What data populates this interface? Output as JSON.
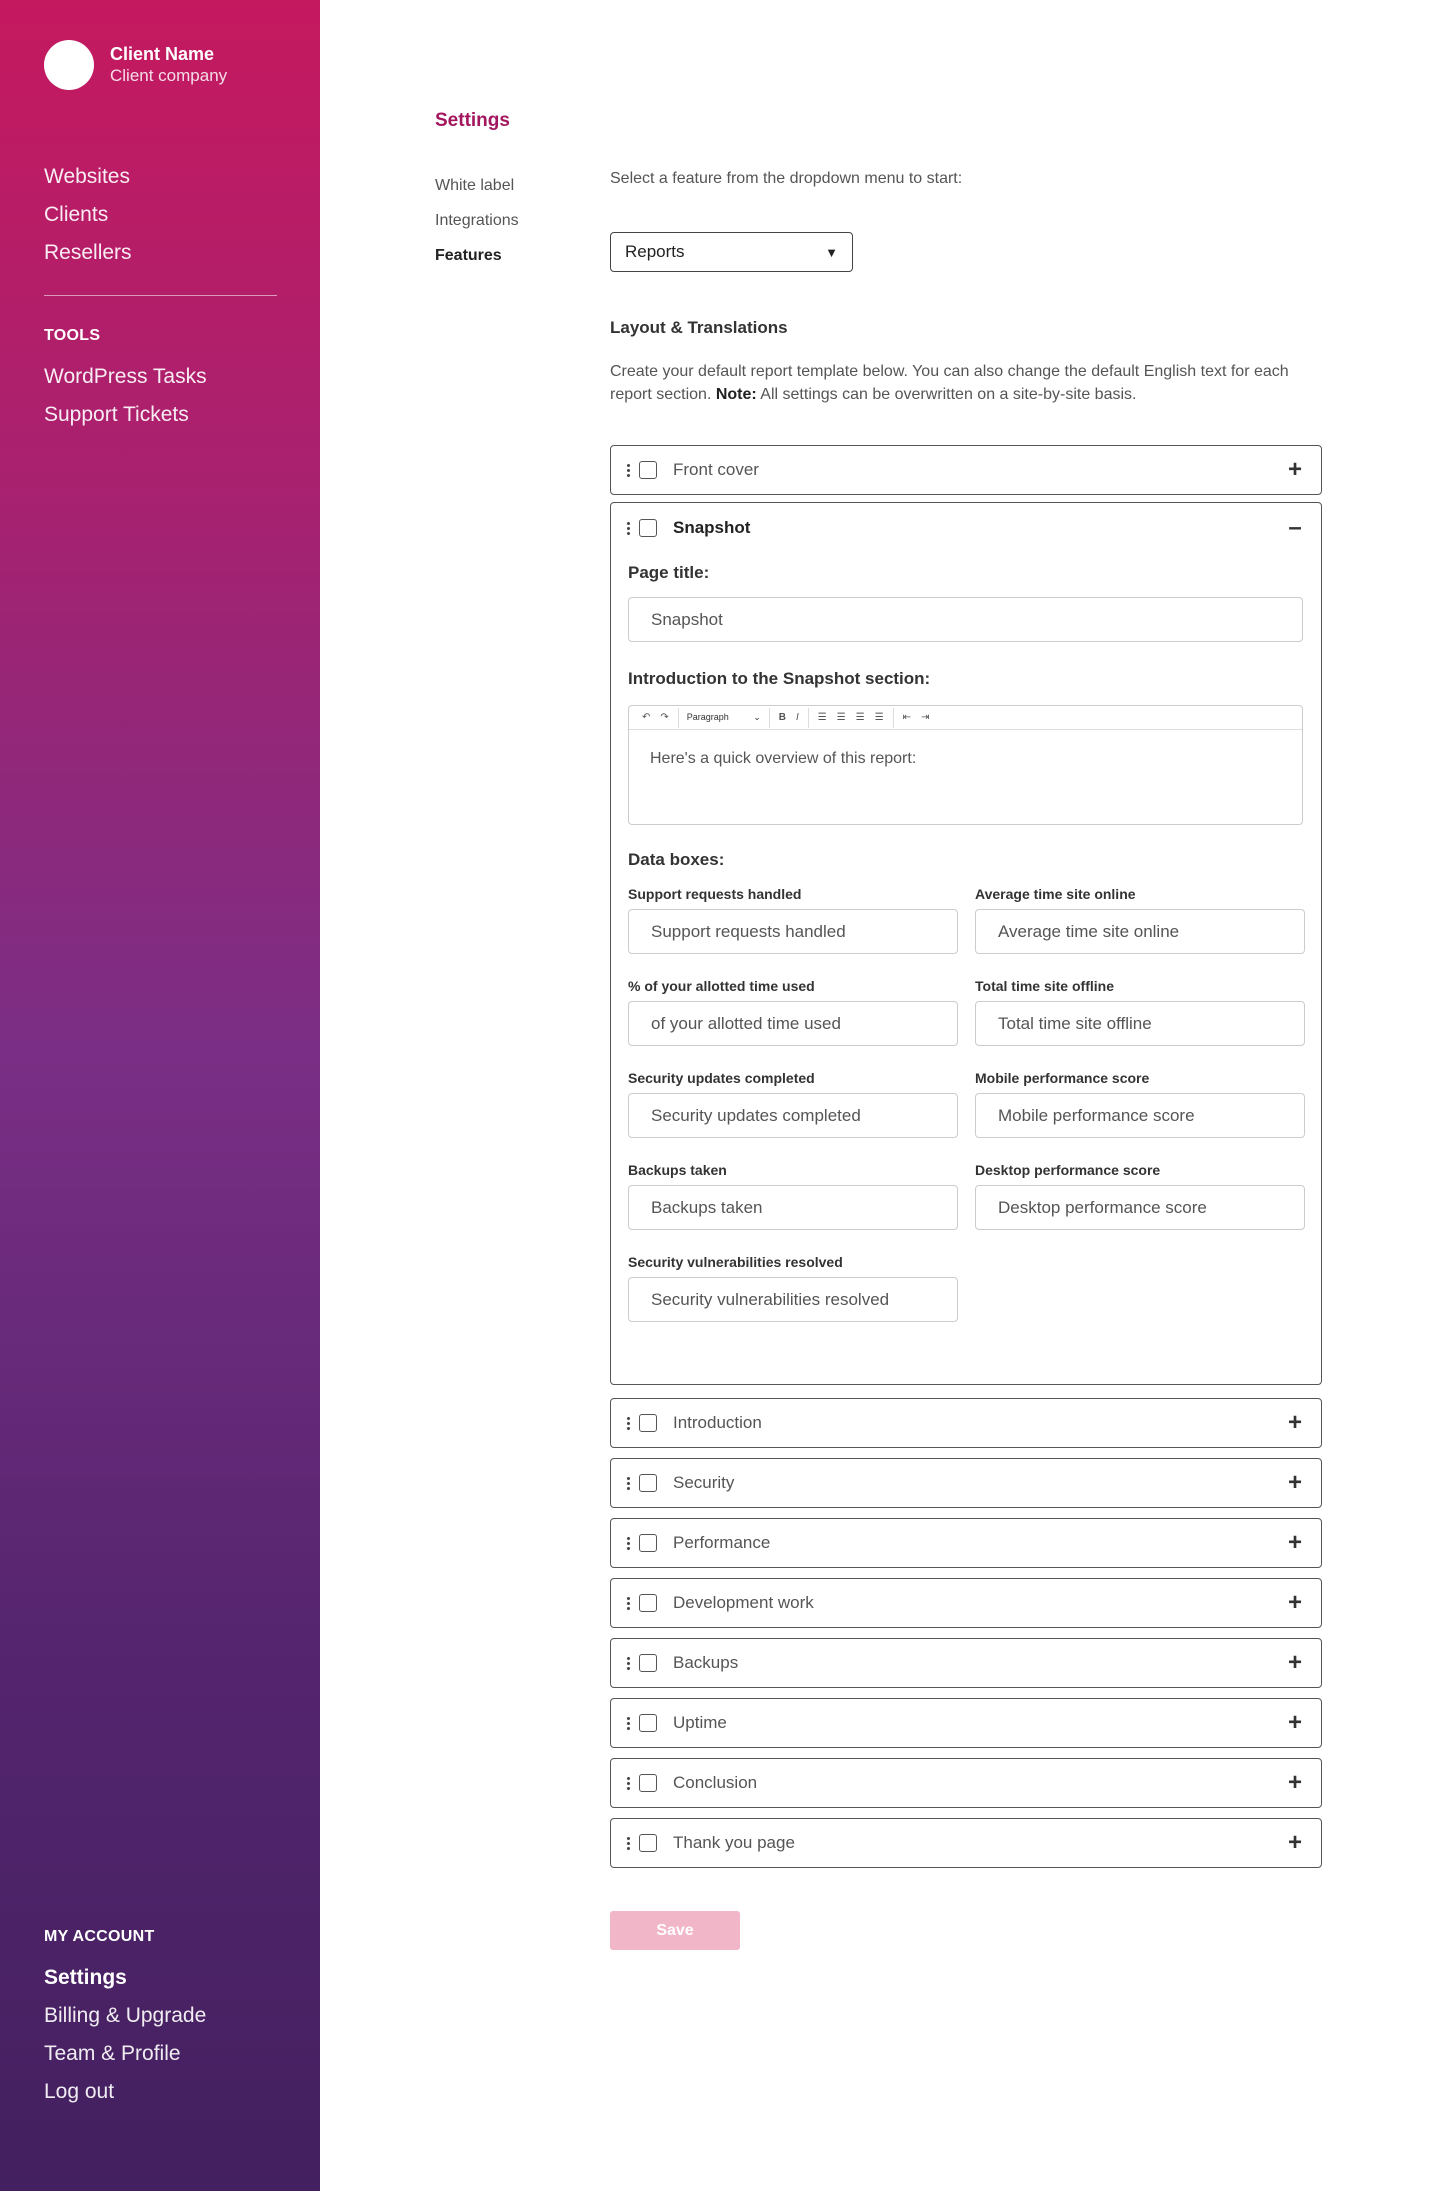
{
  "sidebar": {
    "client_name": "Client Name",
    "client_company": "Client company",
    "nav": [
      "Websites",
      "Clients",
      "Resellers"
    ],
    "tools_label": "TOOLS",
    "tools": [
      "WordPress Tasks",
      "Support Tickets"
    ],
    "account_label": "MY ACCOUNT",
    "account": [
      "Settings",
      "Billing & Upgrade",
      "Team & Profile",
      "Log out"
    ]
  },
  "page": {
    "title": "Settings",
    "subnav": [
      "White label",
      "Integrations",
      "Features"
    ]
  },
  "feature": {
    "hint": "Select a feature from the dropdown menu to start:",
    "selected": "Reports",
    "caret": "▼"
  },
  "layout": {
    "title": "Layout & Translations",
    "desc_prefix": "Create your default report template below. You can also change the default English text for each report section.",
    "desc_note": "Note:",
    "desc_suffix": "All settings can be overwritten on a site-by-site basis."
  },
  "sections": [
    {
      "title": "Front cover",
      "toggle": "+"
    },
    {
      "title": "Snapshot",
      "toggle": "–"
    },
    {
      "title": "Introduction",
      "toggle": "+"
    },
    {
      "title": "Security",
      "toggle": "+"
    },
    {
      "title": "Performance",
      "toggle": "+"
    },
    {
      "title": "Development work",
      "toggle": "+"
    },
    {
      "title": "Backups",
      "toggle": "+"
    },
    {
      "title": "Uptime",
      "toggle": "+"
    },
    {
      "title": "Conclusion",
      "toggle": "+"
    },
    {
      "title": "Thank you page",
      "toggle": "+"
    }
  ],
  "snapshot": {
    "page_title_label": "Page title:",
    "page_title_value": "Snapshot",
    "intro_label": "Introduction to the Snapshot section:",
    "editor_format": "Paragraph",
    "editor_text": "Here's a quick overview of this report:",
    "data_boxes_label": "Data boxes:",
    "boxes": [
      {
        "label": "Support requests handled",
        "placeholder": "Support requests handled"
      },
      {
        "label": "Average time site online",
        "placeholder": "Average time site online"
      },
      {
        "label": "% of your allotted time used",
        "placeholder": "of your allotted time used"
      },
      {
        "label": "Total time site offline",
        "placeholder": "Total time site offline"
      },
      {
        "label": "Security updates completed",
        "placeholder": "Security updates completed"
      },
      {
        "label": "Mobile performance score",
        "placeholder": "Mobile performance score"
      },
      {
        "label": "Backups taken",
        "placeholder": "Backups taken"
      },
      {
        "label": "Desktop performance score",
        "placeholder": "Desktop performance score"
      },
      {
        "label": "Security vulnerabilities resolved",
        "placeholder": "Security vulnerabilities resolved"
      }
    ]
  },
  "save_label": "Save",
  "colors": {
    "accent": "#a3175f",
    "save_bg": "#f2b6c9"
  }
}
